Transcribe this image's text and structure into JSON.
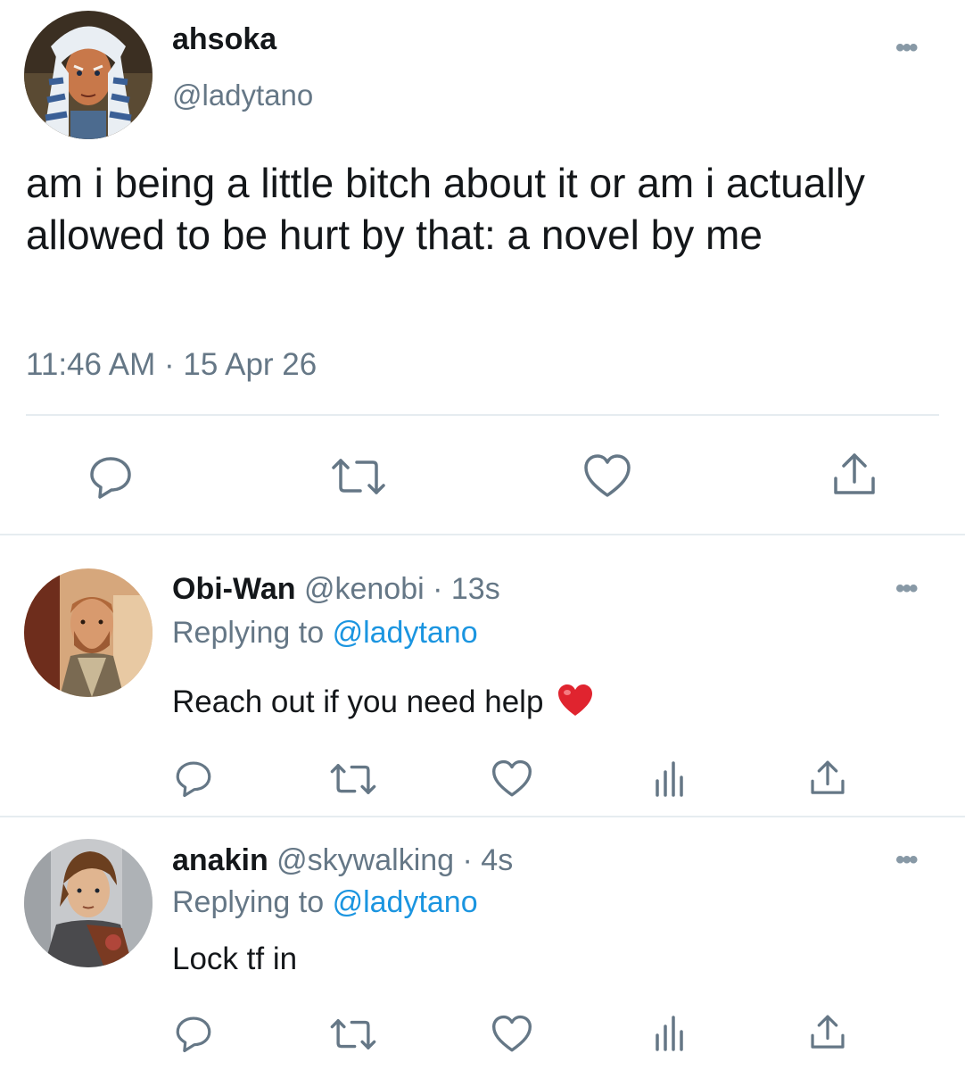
{
  "main_tweet": {
    "display_name": "ahsoka",
    "handle": "@ladytano",
    "text": "am i being a little bitch about it or am i actually allowed to be hurt by that: a novel by me",
    "timestamp": "11:46 AM · 15 Apr 26",
    "actions": [
      "reply-icon",
      "retweet-icon",
      "like-icon",
      "share-icon"
    ]
  },
  "replies": [
    {
      "display_name": "Obi-Wan",
      "handle": "@kenobi",
      "time": "· 13s",
      "replying_prefix": "Replying to",
      "replying_to": "@ladytano",
      "text": "Reach out if you need help",
      "emoji": "❤️",
      "actions": [
        "reply-icon",
        "retweet-icon",
        "like-icon",
        "analytics-icon",
        "share-icon"
      ]
    },
    {
      "display_name": "anakin",
      "handle": "@skywalking",
      "time": "· 4s",
      "replying_prefix": "Replying to",
      "replying_to": "@ladytano",
      "text": "Lock tf in",
      "actions": [
        "reply-icon",
        "retweet-icon",
        "like-icon",
        "analytics-icon",
        "share-icon"
      ]
    }
  ],
  "colors": {
    "link": "#1b95e0",
    "muted": "#657786",
    "divider": "#e6ecf0"
  }
}
